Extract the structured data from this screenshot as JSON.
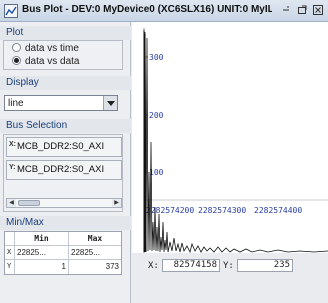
{
  "window": {
    "title": "Bus Plot - DEV:0 MyDevice0 (XC6SLX16) UNIT:0 MyILA0 (...",
    "controls": [
      "restore",
      "maximize",
      "close"
    ]
  },
  "plot_section": {
    "header": "Plot",
    "options": [
      {
        "label": "data vs time",
        "selected": false
      },
      {
        "label": "data vs data",
        "selected": true
      }
    ]
  },
  "display_section": {
    "header": "Display",
    "selected": "line"
  },
  "bus_selection": {
    "header": "Bus Selection",
    "x_axis": {
      "axis": "X:",
      "bus": "MCB_DDR2:S0_AXI"
    },
    "y_axis": {
      "axis": "Y:",
      "bus": "MCB_DDR2:S0_AXI"
    }
  },
  "minmax": {
    "header": "Min/Max",
    "columns": [
      "Min",
      "Max"
    ],
    "rows": [
      {
        "label": "X",
        "min": "22825...",
        "max": "22825..."
      },
      {
        "label": "Y",
        "min": "1",
        "max": "373"
      }
    ]
  },
  "status": {
    "x_label": "X:",
    "x_value": "82574158",
    "y_label": "Y:",
    "y_value": "235"
  },
  "chart_data": {
    "type": "line",
    "y_ticks": [
      100,
      200,
      300
    ],
    "x_ticks": [
      "2282574200",
      "2282574300",
      "2282574400"
    ],
    "color": "#111111",
    "tick_color": "#2a3fa0"
  },
  "colors": {
    "panel_header_text": "#1a3f7a",
    "axis_tick_text": "#2a3fa0"
  }
}
